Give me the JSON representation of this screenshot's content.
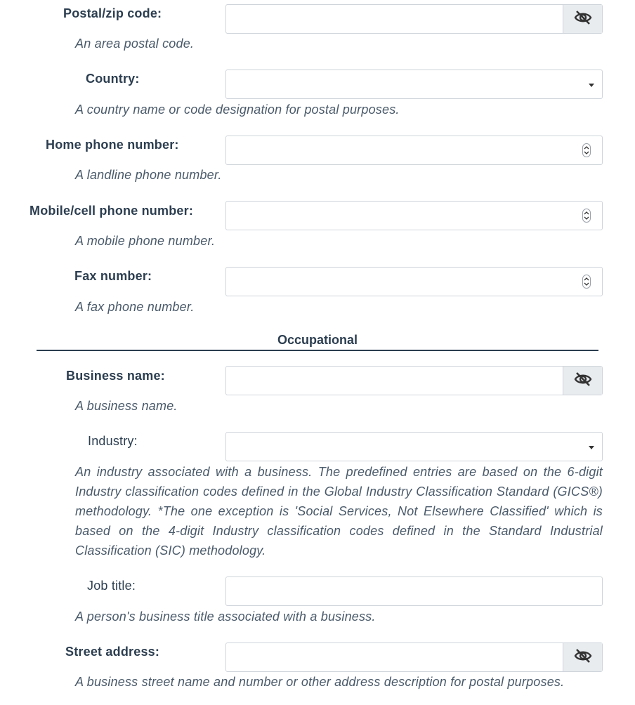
{
  "fields": {
    "postal": {
      "label": "Postal/zip code:",
      "value": "",
      "help": "An area postal code.",
      "addon_icon": "eye-slash-icon"
    },
    "country": {
      "label": "Country:",
      "value": "",
      "help": "A country name or code designation for postal purposes."
    },
    "home_phone": {
      "label": "Home phone number:",
      "value": "",
      "help": "A landline phone number."
    },
    "mobile_phone": {
      "label": "Mobile/cell phone number:",
      "value": "",
      "help": "A mobile phone number."
    },
    "fax": {
      "label": "Fax number:",
      "value": "",
      "help": "A fax phone number."
    },
    "business_name": {
      "label": "Business name:",
      "value": "",
      "help": "A business name.",
      "addon_icon": "eye-slash-icon"
    },
    "industry": {
      "label": "Industry:",
      "value": "",
      "help": "An industry associated with a business. The predefined entries are based on the 6-digit Industry classification codes defined in the Global Industry Classification Standard (GICS®) methodology. *The one exception is 'Social Services, Not Elsewhere Classified' which is based on the 4-digit Industry classification codes defined in the Standard Industrial Classification (SIC) methodology."
    },
    "job_title": {
      "label": "Job title:",
      "value": "",
      "help": "A person's business title associated with a business."
    },
    "street": {
      "label": "Street address:",
      "value": "",
      "help": "A business street name and number or other address description for postal purposes.",
      "addon_icon": "eye-slash-icon"
    }
  },
  "section": {
    "title": "Occupational"
  },
  "colors": {
    "text": "#2c3e50",
    "border": "#ced4da",
    "addon_bg": "#e9ecef"
  }
}
